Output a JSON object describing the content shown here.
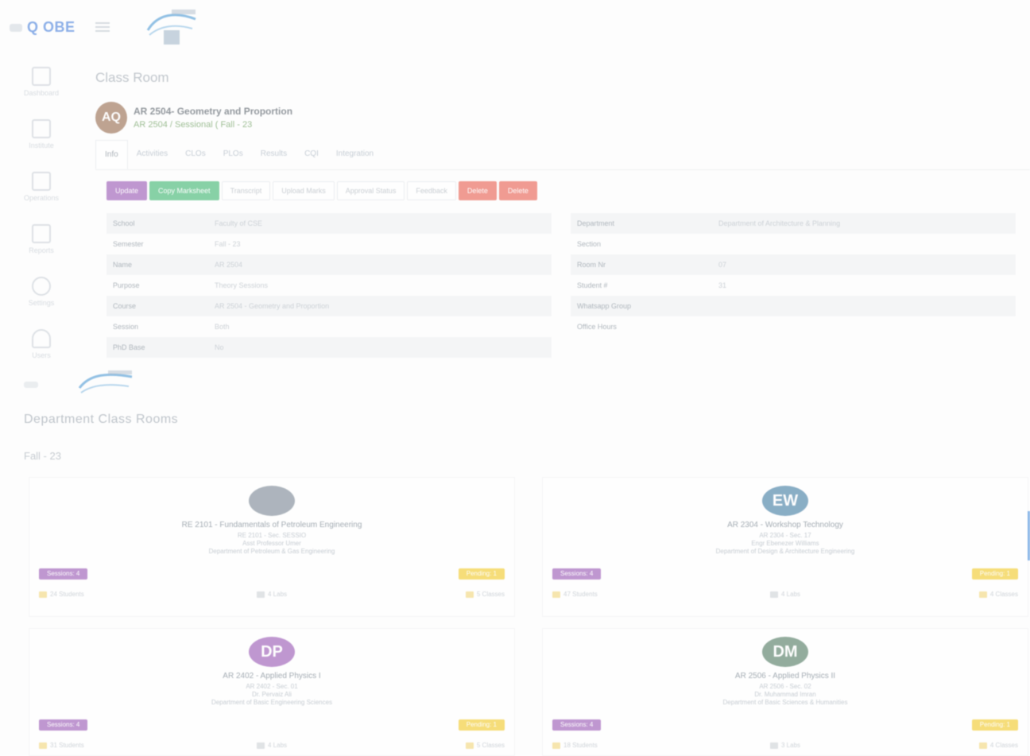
{
  "brand": {
    "name": "Q OBE"
  },
  "sidebar": {
    "items": [
      {
        "label": "Dashboard",
        "icon": "chart-icon"
      },
      {
        "label": "Institute",
        "icon": "building-icon"
      },
      {
        "label": "Operations",
        "icon": "list-icon"
      },
      {
        "label": "Reports",
        "icon": "report-icon"
      },
      {
        "label": "Settings",
        "icon": "gear-icon"
      },
      {
        "label": "Users",
        "icon": "user-icon"
      }
    ]
  },
  "page": {
    "title": "Class Room"
  },
  "course": {
    "initials": "AQ",
    "title": "AR 2504- Geometry and Proportion",
    "subtitle": "AR 2504 / Sessional ( Fall - 23"
  },
  "tabs": [
    "Info",
    "Activities",
    "CLOs",
    "PLOs",
    "Results",
    "CQI",
    "Integration"
  ],
  "actions": {
    "buttons": [
      "Update",
      "Copy Marksheet",
      "Transcript",
      "Upload Marks",
      "Approval Status",
      "Feedback",
      "Delete",
      "Delete"
    ]
  },
  "info_left": [
    {
      "k": "School",
      "v": "Faculty of CSE"
    },
    {
      "k": "Semester",
      "v": "Fall - 23"
    },
    {
      "k": "Name",
      "v": "AR 2504"
    },
    {
      "k": "Purpose",
      "v": "Theory Sessions"
    },
    {
      "k": "Course",
      "v": "AR 2504 - Geometry and Proportion"
    },
    {
      "k": "Session",
      "v": "Both"
    },
    {
      "k": "PhD Base",
      "v": "No"
    }
  ],
  "info_right": [
    {
      "k": "Department",
      "v": "Department of Architecture & Planning"
    },
    {
      "k": "Section",
      "v": ""
    },
    {
      "k": "Room Nr",
      "v": "07"
    },
    {
      "k": "Student #",
      "v": "31"
    },
    {
      "k": "Whatsapp Group",
      "v": ""
    },
    {
      "k": "Office Hours",
      "v": ""
    }
  ],
  "section": {
    "title": "Department Class Rooms",
    "term": "Fall - 23"
  },
  "cards": [
    {
      "initials": "",
      "avatar_color": "#6c7a89",
      "title": "RE 2101 - Fundamentals of Petroleum Engineering",
      "code": "RE 2101 - Sec. SESSIO",
      "teacher": "Asst Professor Umer",
      "dept": "Department of Petroleum & Gas Engineering",
      "badge_left": "Sessions: 4",
      "badge_right": "Pending: 1",
      "students": "24 Students",
      "labs": "4 Labs",
      "classes": "5 Classes"
    },
    {
      "initials": "EW",
      "avatar_color": "#2c6e99",
      "title": "AR 2304 - Workshop Technology",
      "code": "AR 2304 - Sec. 17",
      "teacher": "Engr Ebenezer Williams",
      "dept": "Department of Design & Architecture Engineering",
      "badge_left": "Sessions: 4",
      "badge_right": "Pending: 1",
      "students": "47 Students",
      "labs": "4 Labs",
      "classes": "4 Classes"
    },
    {
      "initials": "DP",
      "avatar_color": "#8e44ad",
      "title": "AR 2402 - Applied Physics I",
      "code": "AR 2402 - Sec. 01",
      "teacher": "Dr. Pervaiz Ali",
      "dept": "Department of Basic Engineering Sciences",
      "badge_left": "Sessions: 4",
      "badge_right": "Pending: 1",
      "students": "31 Students",
      "labs": "4 Labs",
      "classes": "5 Classes"
    },
    {
      "initials": "DM",
      "avatar_color": "#3d6b50",
      "title": "AR 2506 - Applied Physics II",
      "code": "AR 2506 - Sec. 02",
      "teacher": "Dr. Muhammad Imran",
      "dept": "Department of Basic Sciences & Humanities",
      "badge_left": "Sessions: 4",
      "badge_right": "Pending: 1",
      "students": "18 Students",
      "labs": "3 Labs",
      "classes": "4 Classes"
    }
  ]
}
